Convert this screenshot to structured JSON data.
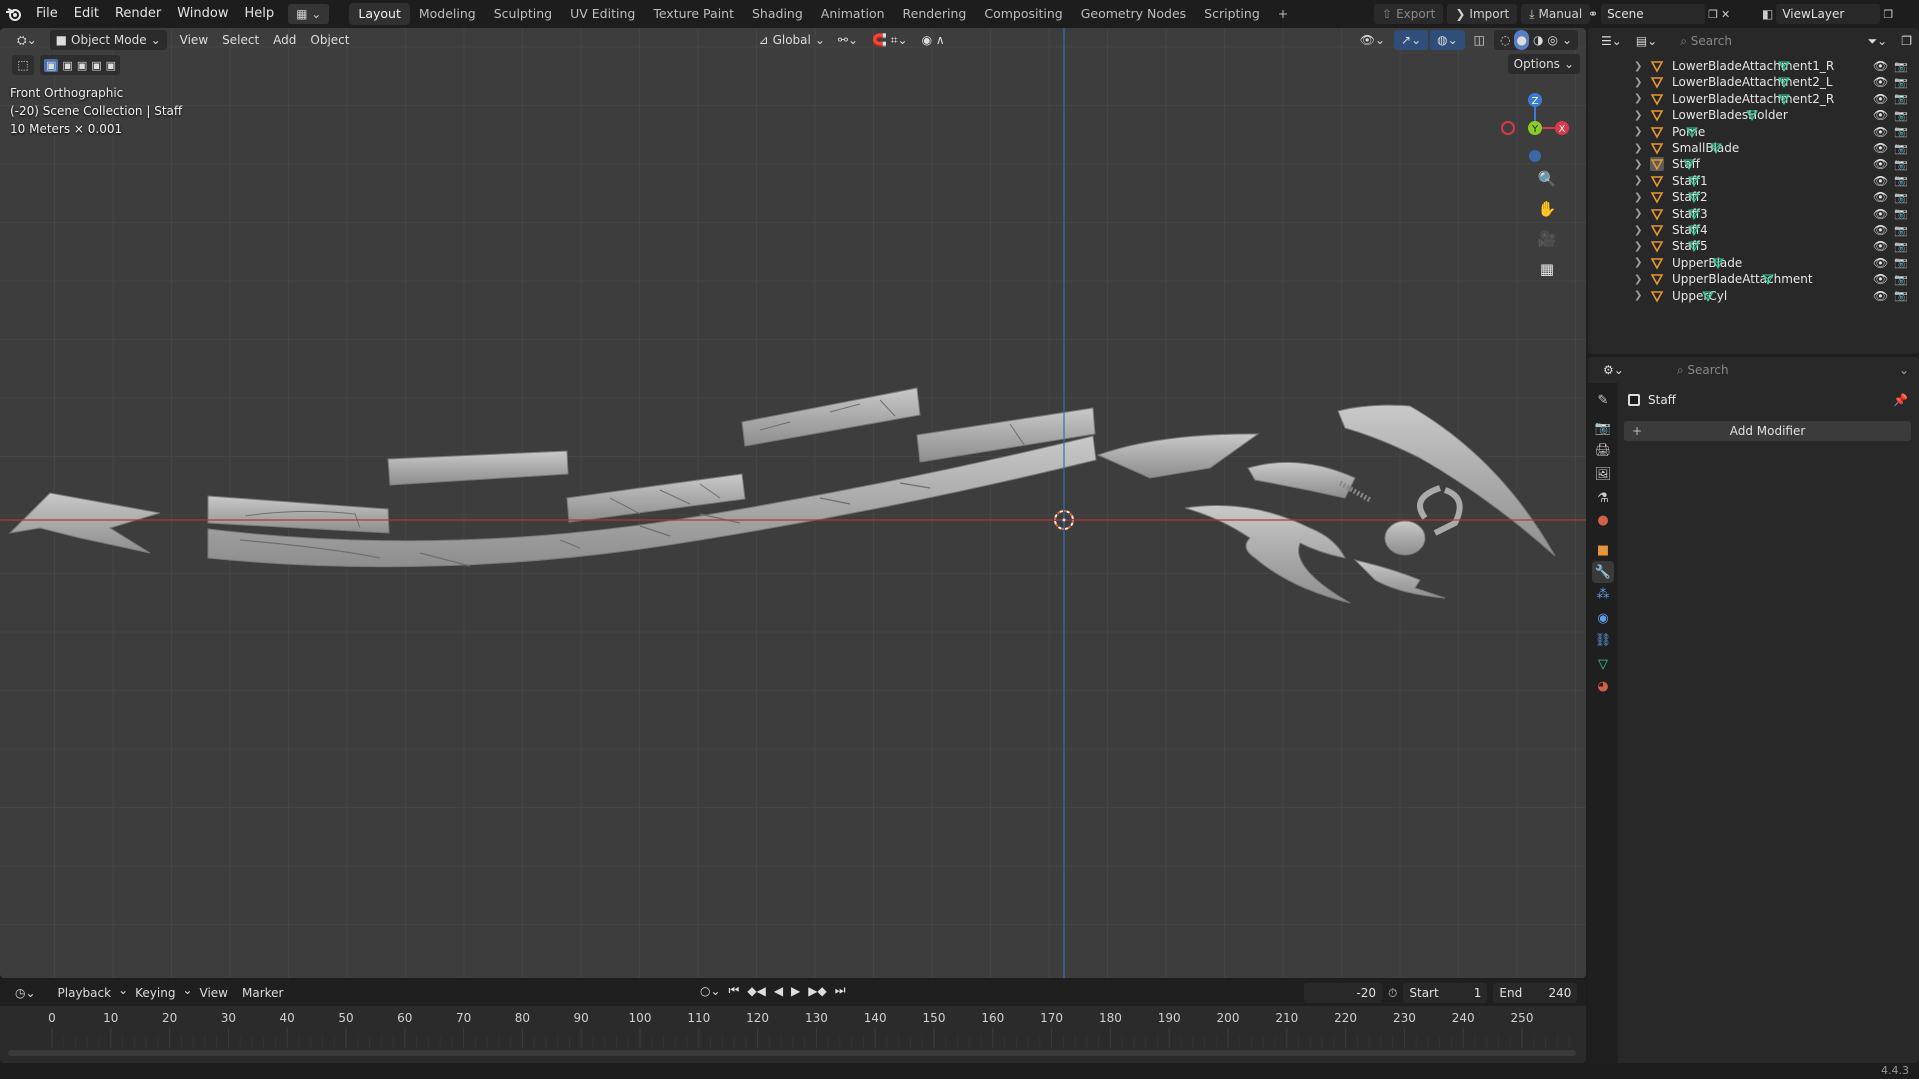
{
  "topbar": {
    "menus": [
      "File",
      "Edit",
      "Render",
      "Window",
      "Help"
    ],
    "workspaces": [
      "Layout",
      "Modeling",
      "Sculpting",
      "UV Editing",
      "Texture Paint",
      "Shading",
      "Animation",
      "Rendering",
      "Compositing",
      "Geometry Nodes",
      "Scripting"
    ],
    "active_workspace": "Layout",
    "add_workspace": "+",
    "export_label": "Export",
    "import_label": "Import",
    "manual_label": "Manual",
    "scene_label": "Scene",
    "viewlayer_label": "ViewLayer"
  },
  "viewport": {
    "mode": "Object Mode",
    "menus": [
      "View",
      "Select",
      "Add",
      "Object"
    ],
    "transform_orientation": "Global",
    "options_label": "Options",
    "view_name": "Front Orthographic",
    "collection_info": "(-20) Scene Collection | Staff",
    "scale_info": "10 Meters × 0.001",
    "gizmo": {
      "z": "Z",
      "y": "Y",
      "x": "X"
    },
    "axis_colors": {
      "x": "#d93a4a",
      "y": "#8ccd22",
      "z": "#3a7bd6"
    }
  },
  "outliner": {
    "search_placeholder": "Search",
    "items": [
      {
        "name": "LowerBladeAttachment1_R"
      },
      {
        "name": "LowerBladeAttachment2_L"
      },
      {
        "name": "LowerBladeAttachment2_R"
      },
      {
        "name": "LowerBladesHolder"
      },
      {
        "name": "Pome"
      },
      {
        "name": "SmallBlade"
      },
      {
        "name": "Staff",
        "selected": true
      },
      {
        "name": "Staff1"
      },
      {
        "name": "Staff2"
      },
      {
        "name": "Staff3"
      },
      {
        "name": "Staff4"
      },
      {
        "name": "Staff5"
      },
      {
        "name": "UpperBlade"
      },
      {
        "name": "UpperBladeAttachment"
      },
      {
        "name": "UpperCyl"
      }
    ]
  },
  "properties": {
    "search_placeholder": "Search",
    "object_name": "Staff",
    "add_modifier_label": "Add Modifier"
  },
  "timeline": {
    "menus": [
      "Playback",
      "Keying",
      "View",
      "Marker"
    ],
    "current_frame": "-20",
    "start_label": "Start",
    "start_value": "1",
    "end_label": "End",
    "end_value": "240",
    "ticks": [
      "0",
      "10",
      "20",
      "30",
      "40",
      "50",
      "60",
      "70",
      "80",
      "90",
      "100",
      "110",
      "120",
      "130",
      "140",
      "150",
      "160",
      "170",
      "180",
      "190",
      "200",
      "210",
      "220",
      "230",
      "240",
      "250"
    ]
  },
  "status": {
    "version": "4.4.3"
  }
}
